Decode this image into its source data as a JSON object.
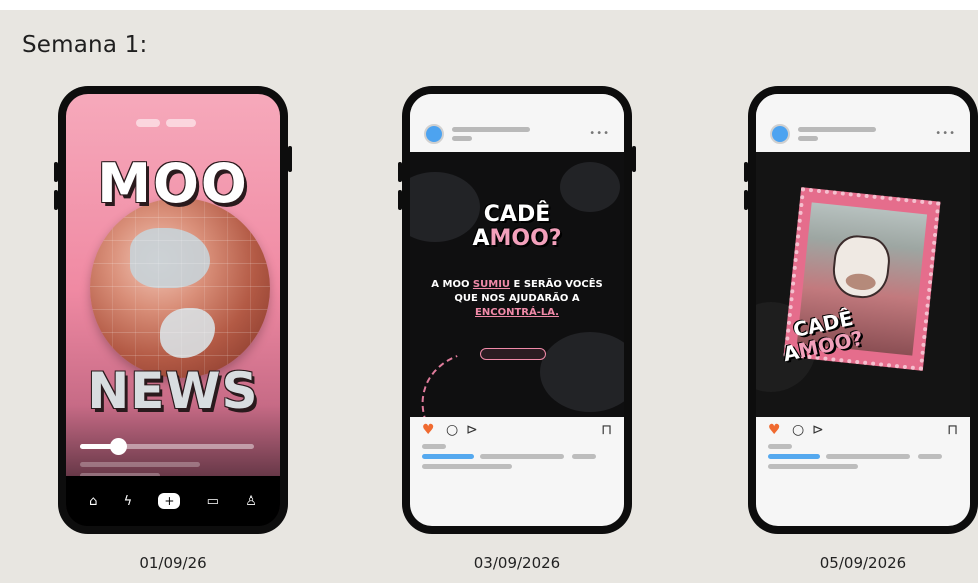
{
  "board": {
    "title": "Semana 1:"
  },
  "posts": [
    {
      "type": "reels",
      "date": "01/09/26",
      "headline_top": "MOO",
      "headline_bottom": "NEWS",
      "progress_fraction": 0.22,
      "nav_icons": [
        "home-icon",
        "bolt-icon",
        "add-icon",
        "shop-icon",
        "profile-icon"
      ],
      "nav_glyphs": [
        "⌂",
        "ϟ",
        "+",
        "▭",
        "♙"
      ]
    },
    {
      "type": "feed-post",
      "date": "03/09/2026",
      "brand_top": "CADÊ",
      "brand_a": "A",
      "brand_moo": "MOO?",
      "caption_pre": "A MOO ",
      "caption_hl1": "SUMIU",
      "caption_mid": " E SERÃO VOCÊS QUE NOS AJUDARÃO A ",
      "caption_hl2": "ENCONTRÁ-LA.",
      "liked": true
    },
    {
      "type": "feed-post",
      "date": "05/09/2026",
      "brand_top": "CADÊ",
      "brand_a": "A",
      "brand_moo": "MOO?",
      "liked": true
    }
  ],
  "colors": {
    "board_bg": "#e8e6e1",
    "phone_frame": "#0d0d0d",
    "accent_pink": "#f08aa8",
    "like_orange": "#f06a30",
    "link_blue": "#55a9ef"
  }
}
